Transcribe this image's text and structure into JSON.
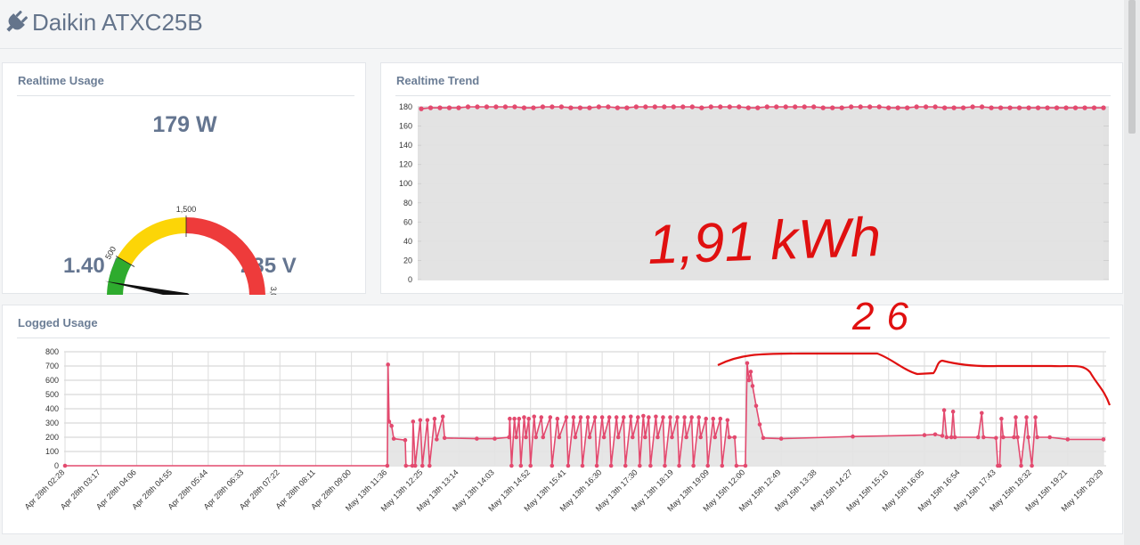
{
  "header": {
    "title": "Daikin ATXC25B",
    "icon": "plug-icon"
  },
  "realtime_usage": {
    "title": "Realtime Usage",
    "power": "179 W",
    "current": "1.40 A",
    "voltage": "235 V",
    "gauge": {
      "min": 0,
      "max": 3000,
      "value": 179,
      "ticks": [
        {
          "value": 500,
          "label": "500"
        },
        {
          "value": 1500,
          "label": "1,500"
        },
        {
          "value": 3000,
          "label": "3,000"
        }
      ],
      "bands": [
        {
          "from": 0,
          "to": 500,
          "color": "#2eab2e"
        },
        {
          "from": 500,
          "to": 1500,
          "color": "#fcd507"
        },
        {
          "from": 1500,
          "to": 3000,
          "color": "#ee3b3b"
        }
      ]
    }
  },
  "realtime_trend": {
    "title": "Realtime Trend"
  },
  "logged_usage": {
    "title": "Logged Usage"
  },
  "annotations": {
    "energy": "1,91 kWh",
    "number": "26",
    "ink_color": "#e01010"
  },
  "colors": {
    "series": "#e34a6f",
    "fill": "#e3e3e3",
    "text": "#647590"
  },
  "chart_data": [
    {
      "type": "area",
      "series": [
        {
          "values": [
            178,
            179,
            179,
            179,
            179,
            180,
            180,
            180,
            180,
            180,
            180,
            179,
            179,
            180,
            180,
            180,
            179,
            179,
            179,
            180,
            180,
            179,
            179,
            180,
            180,
            180,
            180,
            180,
            180,
            180,
            179,
            180,
            180,
            180,
            180,
            179,
            179,
            180,
            180,
            180,
            180,
            180,
            180,
            179,
            179,
            179,
            180,
            180,
            180,
            180,
            179,
            179,
            179,
            180,
            180,
            180,
            179,
            179,
            179,
            180,
            180,
            179,
            179,
            179,
            179,
            179,
            179,
            179,
            179,
            179,
            179,
            179,
            179,
            179
          ]
        }
      ],
      "yticks": [
        0,
        20,
        40,
        60,
        80,
        100,
        120,
        140,
        160,
        180
      ],
      "ylim": [
        0,
        180
      ],
      "grid": true
    },
    {
      "type": "area",
      "categories": [
        "Apr 28th 02:28",
        "Apr 28th 03:17",
        "Apr 28th 04:06",
        "Apr 28th 04:55",
        "Apr 28th 05:44",
        "Apr 28th 06:33",
        "Apr 28th 07:22",
        "Apr 28th 08:11",
        "Apr 28th 09:00",
        "May 13th 11:36",
        "May 13th 12:25",
        "May 13th 13:14",
        "May 13th 14:03",
        "May 13th 14:52",
        "May 13th 15:41",
        "May 13th 16:30",
        "May 13th 17:30",
        "May 13th 18:19",
        "May 13th 19:09",
        "May 15th 12:00",
        "May 15th 12:49",
        "May 15th 13:38",
        "May 15th 14:27",
        "May 15th 15:16",
        "May 15th 16:05",
        "May 15th 16:54",
        "May 15th 17:43",
        "May 15th 18:32",
        "May 15th 19:21",
        "May 15th 20:29"
      ],
      "yticks": [
        0,
        100,
        200,
        300,
        400,
        500,
        600,
        700,
        800
      ],
      "ylim": [
        0,
        800
      ],
      "grid": true,
      "series": [
        {
          "points": [
            [
              0,
              0
            ],
            [
              9,
              0
            ],
            [
              9.02,
              710
            ],
            [
              9.05,
              310
            ],
            [
              9.12,
              280
            ],
            [
              9.18,
              190
            ],
            [
              9.5,
              180
            ],
            [
              9.52,
              0
            ],
            [
              9.7,
              0
            ],
            [
              9.72,
              310
            ],
            [
              9.78,
              0
            ],
            [
              9.92,
              320
            ],
            [
              9.98,
              0
            ],
            [
              10.12,
              320
            ],
            [
              10.18,
              0
            ],
            [
              10.32,
              330
            ],
            [
              10.38,
              185
            ],
            [
              10.55,
              345
            ],
            [
              10.6,
              195
            ],
            [
              11.5,
              190
            ],
            [
              12,
              190
            ],
            [
              12.4,
              200
            ],
            [
              12.42,
              330
            ],
            [
              12.47,
              0
            ],
            [
              12.55,
              330
            ],
            [
              12.6,
              200
            ],
            [
              12.68,
              330
            ],
            [
              12.73,
              0
            ],
            [
              12.82,
              340
            ],
            [
              12.87,
              200
            ],
            [
              12.95,
              330
            ],
            [
              13.0,
              0
            ],
            [
              13.1,
              345
            ],
            [
              13.15,
              200
            ],
            [
              13.3,
              340
            ],
            [
              13.35,
              200
            ],
            [
              13.55,
              340
            ],
            [
              13.6,
              0
            ],
            [
              13.75,
              330
            ],
            [
              13.8,
              200
            ],
            [
              14.0,
              340
            ],
            [
              14.05,
              0
            ],
            [
              14.2,
              340
            ],
            [
              14.25,
              200
            ],
            [
              14.4,
              340
            ],
            [
              14.45,
              0
            ],
            [
              14.6,
              340
            ],
            [
              14.65,
              200
            ],
            [
              14.8,
              340
            ],
            [
              14.85,
              0
            ],
            [
              15.0,
              340
            ],
            [
              15.05,
              200
            ],
            [
              15.2,
              340
            ],
            [
              15.25,
              0
            ],
            [
              15.4,
              340
            ],
            [
              15.45,
              200
            ],
            [
              15.6,
              340
            ],
            [
              15.65,
              0
            ],
            [
              15.8,
              345
            ],
            [
              15.85,
              200
            ],
            [
              16.0,
              340
            ],
            [
              16.05,
              0
            ],
            [
              16.15,
              350
            ],
            [
              16.2,
              200
            ],
            [
              16.3,
              340
            ],
            [
              16.35,
              0
            ],
            [
              16.5,
              345
            ],
            [
              16.55,
              200
            ],
            [
              16.7,
              340
            ],
            [
              16.75,
              0
            ],
            [
              16.9,
              340
            ],
            [
              16.95,
              200
            ],
            [
              17.1,
              340
            ],
            [
              17.15,
              0
            ],
            [
              17.3,
              340
            ],
            [
              17.35,
              200
            ],
            [
              17.5,
              340
            ],
            [
              17.55,
              0
            ],
            [
              17.7,
              340
            ],
            [
              17.75,
              200
            ],
            [
              17.9,
              330
            ],
            [
              17.95,
              0
            ],
            [
              18.1,
              330
            ],
            [
              18.15,
              200
            ],
            [
              18.3,
              330
            ],
            [
              18.35,
              0
            ],
            [
              18.5,
              320
            ],
            [
              18.55,
              200
            ],
            [
              18.7,
              200
            ],
            [
              18.75,
              0
            ],
            [
              19.0,
              0
            ],
            [
              19.05,
              720
            ],
            [
              19.1,
              600
            ],
            [
              19.15,
              660
            ],
            [
              19.2,
              560
            ],
            [
              19.3,
              420
            ],
            [
              19.4,
              290
            ],
            [
              19.5,
              195
            ],
            [
              20,
              190
            ],
            [
              22,
              205
            ],
            [
              24,
              215
            ],
            [
              24.3,
              220
            ],
            [
              24.5,
              210
            ],
            [
              24.55,
              390
            ],
            [
              24.62,
              200
            ],
            [
              24.75,
              200
            ],
            [
              24.8,
              380
            ],
            [
              24.85,
              200
            ],
            [
              25.5,
              200
            ],
            [
              25.6,
              370
            ],
            [
              25.65,
              200
            ],
            [
              26.0,
              195
            ],
            [
              26.05,
              0
            ],
            [
              26.1,
              0
            ],
            [
              26.15,
              330
            ],
            [
              26.2,
              200
            ],
            [
              26.5,
              200
            ],
            [
              26.55,
              340
            ],
            [
              26.6,
              200
            ],
            [
              26.7,
              0
            ],
            [
              26.85,
              340
            ],
            [
              26.9,
              200
            ],
            [
              27.0,
              0
            ],
            [
              27.1,
              340
            ],
            [
              27.15,
              200
            ],
            [
              27.5,
              200
            ],
            [
              28,
              185
            ],
            [
              29,
              185
            ]
          ]
        }
      ]
    }
  ]
}
